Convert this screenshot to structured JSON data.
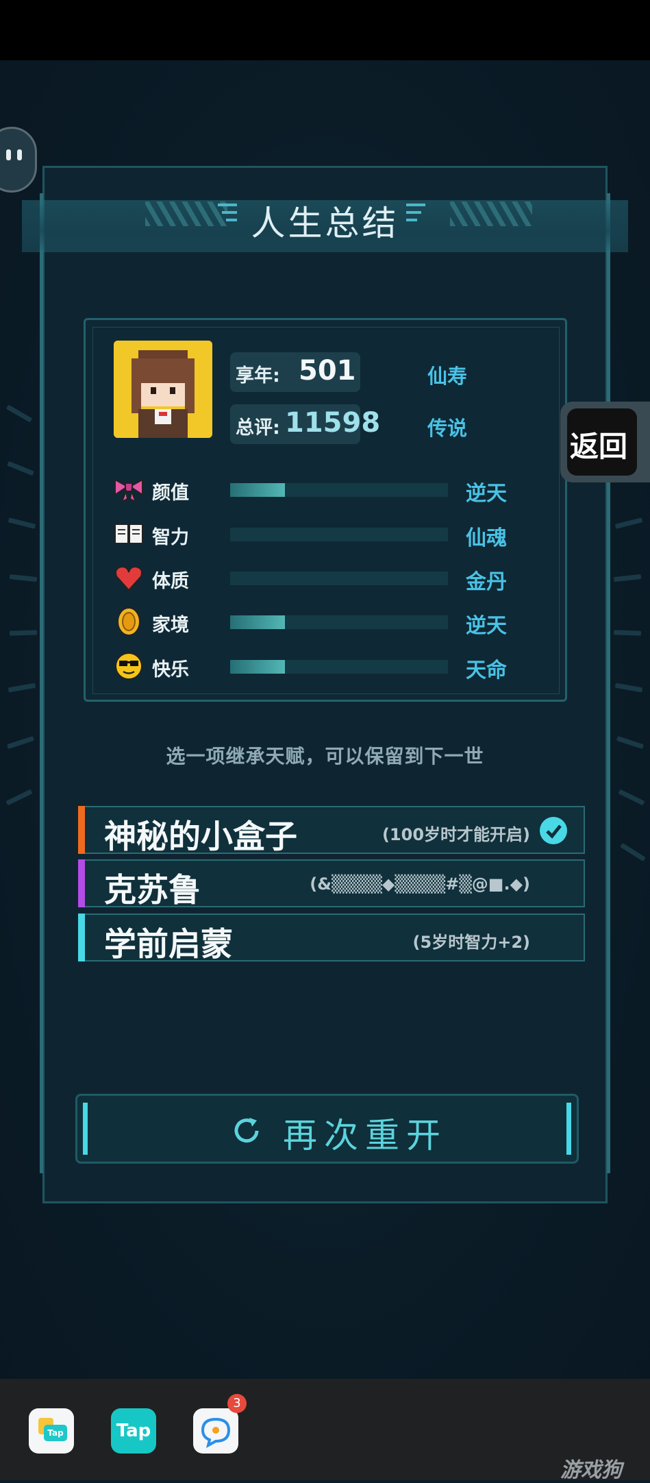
{
  "panel": {
    "title": "人生总结"
  },
  "summary": {
    "age_label": "享年:",
    "age_value": "501",
    "age_rank": "仙寿",
    "score_label": "总评:",
    "score_value": "11598",
    "score_rank": "传说"
  },
  "attributes": [
    {
      "name": "颜值",
      "icon": "bow-icon",
      "level": "逆天",
      "fill": 0.25
    },
    {
      "name": "智力",
      "icon": "book-icon",
      "level": "仙魂",
      "fill": 0.0
    },
    {
      "name": "体质",
      "icon": "heart-icon",
      "level": "金丹",
      "fill": 0.0
    },
    {
      "name": "家境",
      "icon": "coin-icon",
      "level": "逆天",
      "fill": 0.25
    },
    {
      "name": "快乐",
      "icon": "sunglasses-face-icon",
      "level": "天命",
      "fill": 0.25
    }
  ],
  "hint": "选一项继承天赋，可以保留到下一世",
  "talents": [
    {
      "name": "神秘的小盒子",
      "desc": "(100岁时才能开启)",
      "color": "#f06a1d",
      "selected": true
    },
    {
      "name": "克苏鲁",
      "desc": "(&▒▒▒▒◆▒▒▒▒#▒@■.◆)",
      "color": "#b24ce6",
      "selected": false
    },
    {
      "name": "学前启蒙",
      "desc": "(5岁时智力+2)",
      "color": "#49d8e6",
      "selected": false
    }
  ],
  "restart_label": "再次重开",
  "back_label": "返回",
  "dock": {
    "badge_count": "3",
    "apps": [
      "files-app-icon",
      "tap-app-icon",
      "chat-app-icon"
    ],
    "tap_label": "Tap",
    "files_label": "Tap"
  },
  "watermark": "游戏狗",
  "colors": {
    "accent": "#49c2e5",
    "panel": "#0e2531",
    "background": "#0b1c27"
  }
}
